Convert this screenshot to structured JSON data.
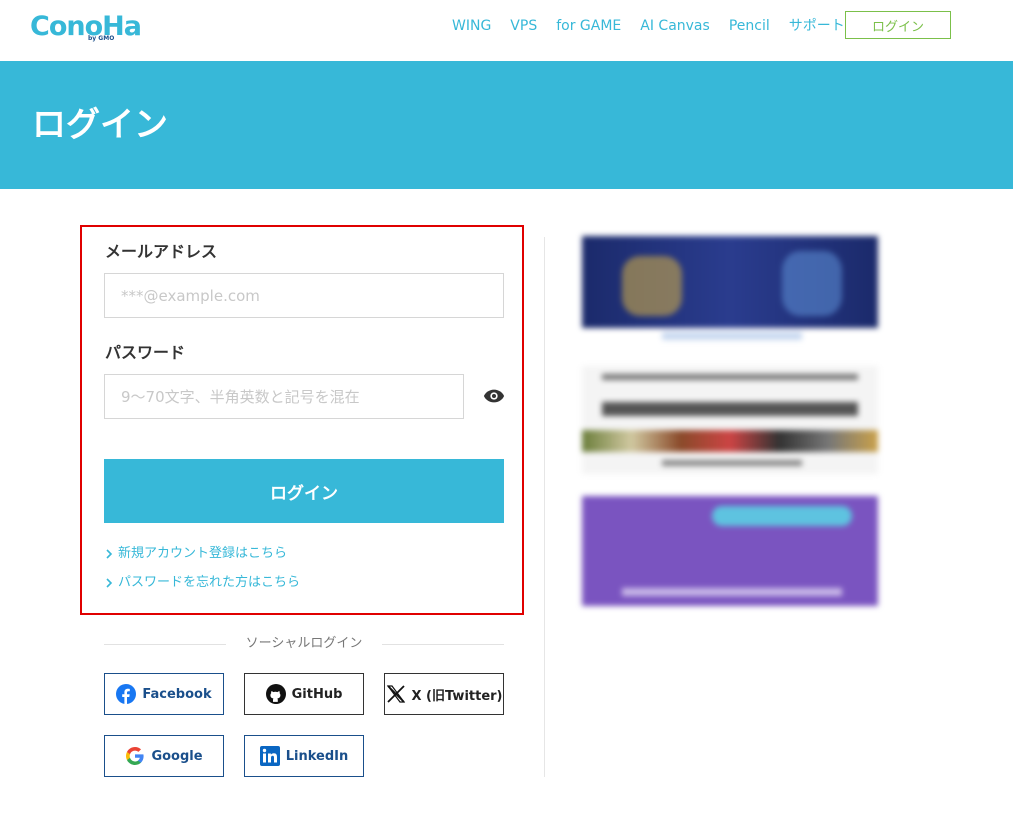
{
  "header": {
    "logo_text": "ConoHa",
    "logo_sub": "by GMO",
    "nav": [
      "WING",
      "VPS",
      "for GAME",
      "AI Canvas",
      "Pencil",
      "サポート"
    ],
    "login_label": "ログイン"
  },
  "banner": {
    "title": "ログイン"
  },
  "form": {
    "email_label": "メールアドレス",
    "email_placeholder": "***@example.com",
    "email_value": "",
    "password_label": "パスワード",
    "password_placeholder": "9〜70文字、半角英数と記号を混在",
    "password_value": "",
    "submit_label": "ログイン",
    "links": [
      "新規アカウント登録はこちら",
      "パスワードを忘れた方はこちら"
    ]
  },
  "social": {
    "title": "ソーシャルログイン",
    "buttons": [
      "Facebook",
      "GitHub",
      "X (旧Twitter)",
      "Google",
      "LinkedIn"
    ]
  },
  "colors": {
    "brand": "#37b8d8",
    "login_outline": "#7bc04a",
    "highlight": "#e00000",
    "social_blue": "#1a4f8b"
  }
}
